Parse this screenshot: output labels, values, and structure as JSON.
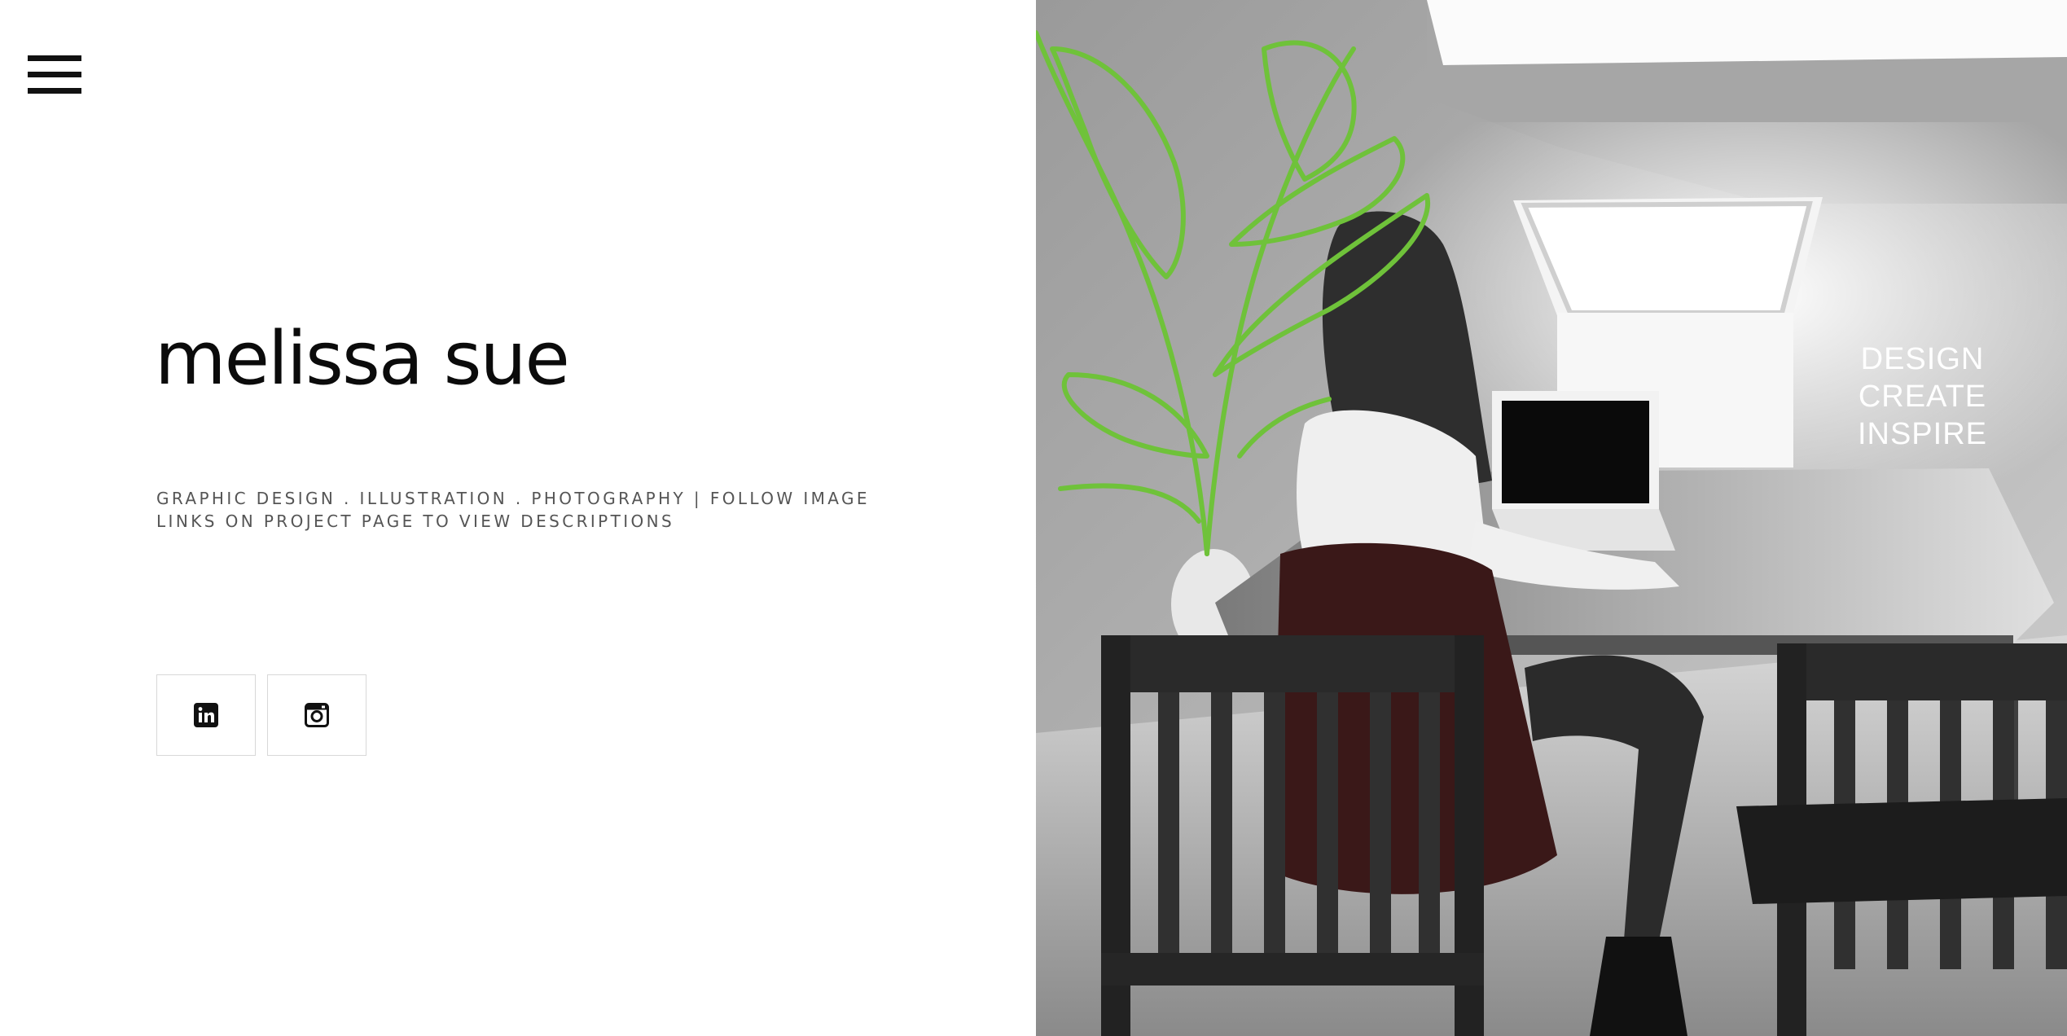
{
  "header": {
    "menu_icon": "hamburger-menu-icon"
  },
  "hero": {
    "title": "melissa sue",
    "tagline_line1": "GRAPHIC DESIGN . ILLUSTRATION . PHOTOGRAPHY | FOLLOW IMAGE",
    "tagline_line2": "LINKS ON PROJECT PAGE TO VIEW DESCRIPTIONS"
  },
  "social": {
    "items": [
      {
        "icon": "linkedin-icon"
      },
      {
        "icon": "instagram-icon"
      }
    ]
  },
  "photo": {
    "overlay_lines": [
      "DESIGN",
      "CREATE",
      "INSPIRE"
    ],
    "plant_outline_color": "#6fc23a"
  },
  "colors": {
    "background": "#ffffff",
    "title": "#0b0b0b",
    "tagline": "#555555",
    "overlay_text": "#ffffff"
  }
}
